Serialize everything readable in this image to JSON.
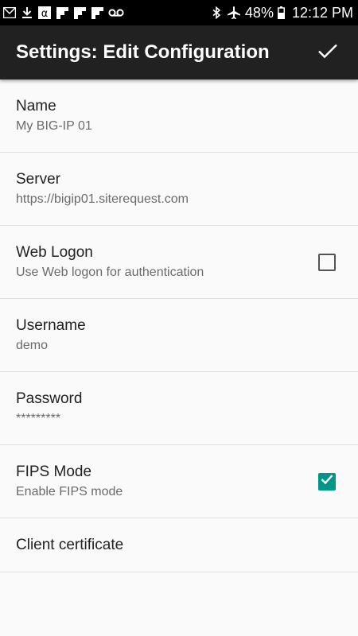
{
  "status_bar": {
    "battery": "48%",
    "time": "12:12 PM",
    "left_icons": [
      "mail-icon",
      "download-icon",
      "alpha-app-icon",
      "flipboard-icon",
      "flipboard-icon",
      "flipboard-icon",
      "voicemail-icon"
    ],
    "right_icons": [
      "bluetooth-icon",
      "airplane-mode-icon",
      "battery-icon"
    ]
  },
  "app_bar": {
    "title": "Settings: Edit Configuration",
    "confirm_icon": "check-icon"
  },
  "preferences": [
    {
      "title": "Name",
      "summary": "My BIG-IP 01"
    },
    {
      "title": "Server",
      "summary": "https://bigip01.siterequest.com"
    },
    {
      "title": "Web Logon",
      "summary": "Use Web logon for authentication",
      "checked": false
    },
    {
      "title": "Username",
      "summary": "demo"
    },
    {
      "title": "Password",
      "summary": "*********"
    },
    {
      "title": "FIPS Mode",
      "summary": "Enable FIPS mode",
      "checked": true
    },
    {
      "title": "Client certificate"
    }
  ],
  "colors": {
    "app_bar": "#212121",
    "accent": "#009688",
    "status_bar": "#000000",
    "background": "#fafafa"
  }
}
